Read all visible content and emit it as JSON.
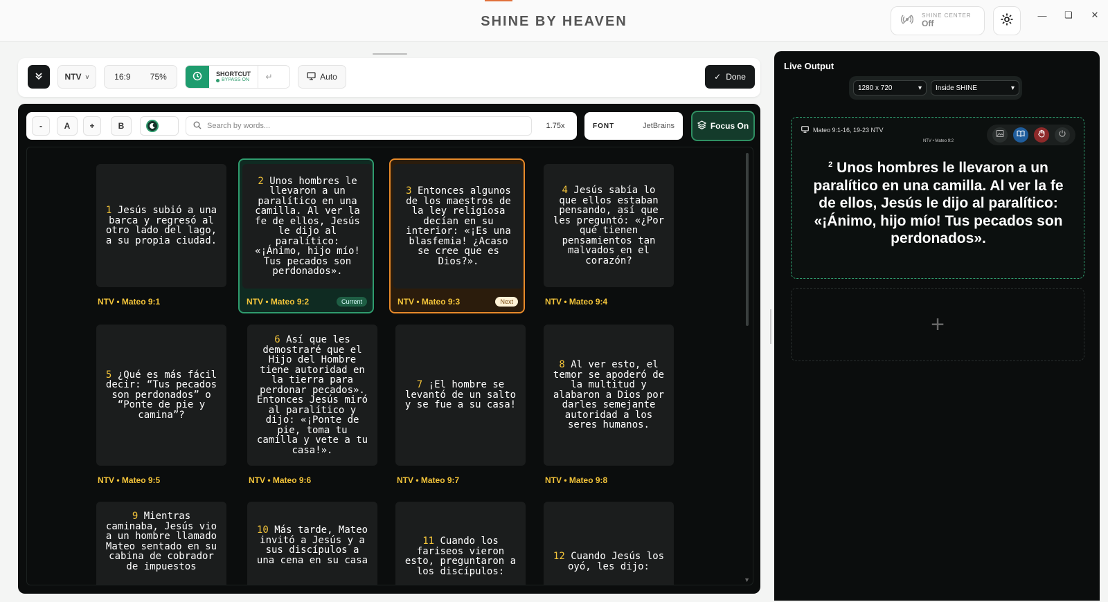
{
  "app": {
    "title": "SHINE BY HEAVEN",
    "shine_center_label": "SHINE CENTER",
    "shine_center_value": "Off"
  },
  "toolbar": {
    "version": "NTV",
    "version_caret": "v",
    "ratio": "16:9",
    "zoom": "75%",
    "shortcut_label": "SHORTCUT",
    "shortcut_status": "BYPASS ON",
    "auto_label": "Auto",
    "done_label": "Done"
  },
  "editor": {
    "size_minus": "-",
    "size_a": "A",
    "size_plus": "+",
    "bold": "B",
    "search_placeholder": "Search by words...",
    "scale": "1.75x",
    "font_label": "FONT",
    "font_value": "JetBrains",
    "focus_label": "Focus On"
  },
  "verses": [
    {
      "num": "1",
      "text": "Jesús subió a una barca y regresó al otro lado del lago, a su propia ciudad.",
      "ref": "NTV • Mateo 9:1",
      "state": "",
      "badge": ""
    },
    {
      "num": "2",
      "text": "Unos hombres le llevaron a un paralítico en una camilla. Al ver la fe de ellos, Jesús le dijo al paralítico: «¡Ánimo, hijo mío! Tus pecados son perdonados».",
      "ref": "NTV • Mateo 9:2",
      "state": "current",
      "badge": "Current"
    },
    {
      "num": "3",
      "text": "Entonces algunos de los maestros de la ley religiosa decían en su interior: «¡Es una blasfemia! ¿Acaso se cree que es Dios?».",
      "ref": "NTV • Mateo 9:3",
      "state": "next",
      "badge": "Next"
    },
    {
      "num": "4",
      "text": "Jesús sabía lo que ellos estaban pensando, así que les preguntó: «¿Por qué tienen pensamientos tan malvados en el corazón?",
      "ref": "NTV • Mateo 9:4",
      "state": "",
      "badge": ""
    },
    {
      "num": "5",
      "text": "¿Qué es más fácil decir: “Tus pecados son perdonados” o “Ponte de pie y camina”?",
      "ref": "NTV • Mateo 9:5",
      "state": "",
      "badge": ""
    },
    {
      "num": "6",
      "text": "Así que les demostraré que el Hijo del Hombre tiene autoridad en la tierra para perdonar pecados». Entonces Jesús miró al paralítico y dijo: «¡Ponte de pie, toma tu camilla y vete a tu casa!».",
      "ref": "NTV • Mateo 9:6",
      "state": "",
      "badge": ""
    },
    {
      "num": "7",
      "text": "¡El hombre se levantó de un salto y se fue a su casa!",
      "ref": "NTV • Mateo 9:7",
      "state": "",
      "badge": ""
    },
    {
      "num": "8",
      "text": "Al ver esto, el temor se apoderó de la multitud y alabaron a Dios por darles semejante autoridad a los seres humanos.",
      "ref": "NTV • Mateo 9:8",
      "state": "",
      "badge": ""
    },
    {
      "num": "9",
      "text": "Mientras caminaba, Jesús vio a un hombre llamado Mateo sentado en su cabina de cobrador de impuestos",
      "ref": "",
      "state": "",
      "badge": ""
    },
    {
      "num": "10",
      "text": "Más tarde, Mateo invitó a Jesús y a sus discípulos a una cena en su casa",
      "ref": "",
      "state": "",
      "badge": ""
    },
    {
      "num": "11",
      "text": "Cuando los fariseos vieron esto, preguntaron a los discípulos:",
      "ref": "",
      "state": "",
      "badge": ""
    },
    {
      "num": "12",
      "text": "Cuando Jesús los oyó, les dijo:",
      "ref": "",
      "state": "",
      "badge": ""
    }
  ],
  "live": {
    "title": "Live Output",
    "resolution": "1280 x 720",
    "target": "Inside SHINE",
    "preview_ref": "Mateo 9:1-16, 19-23 NTV",
    "preview_sub": "NTV • Mateo 9:2",
    "preview_num": "2",
    "preview_text": "Unos hombres le llevaron a un paralítico en una camilla. Al ver la fe de ellos, Jesús le dijo al paralítico: «¡Ánimo, hijo mío! Tus pecados son perdonados».",
    "add_symbol": "+"
  },
  "colors": {
    "accent_green": "#2f9c6e",
    "next_orange": "#e88a2a",
    "verse_gold": "#f3c43a",
    "panel_dark": "#0b0d0d"
  }
}
